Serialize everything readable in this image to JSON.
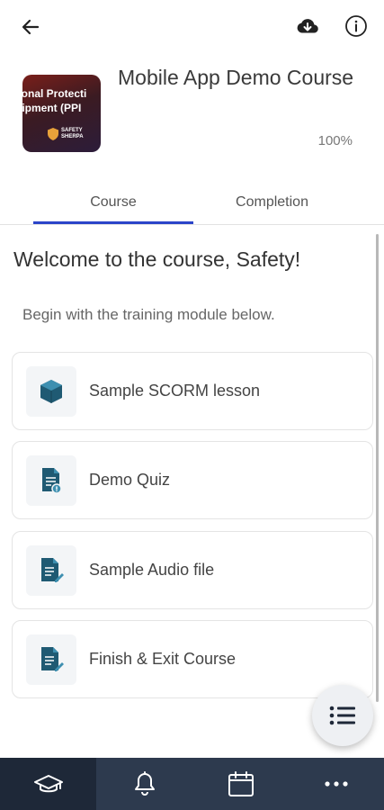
{
  "topbar": {
    "back_icon": "arrow-left-icon",
    "download_icon": "cloud-download-icon",
    "info_icon": "info-icon"
  },
  "course": {
    "thumbnail_line1": "sonal Protecti",
    "thumbnail_line2": "uipment (PPI",
    "thumbnail_badge_line1": "SAFETY",
    "thumbnail_badge_line2": "SHERPA",
    "title": "Mobile App Demo Course",
    "progress": "100%"
  },
  "tabs": [
    {
      "label": "Course",
      "active": true
    },
    {
      "label": "Completion",
      "active": false
    }
  ],
  "content": {
    "welcome": "Welcome to the course, Safety!",
    "subtitle": "Begin with the training module below."
  },
  "modules": [
    {
      "label": "Sample SCORM lesson",
      "icon": "cube-icon"
    },
    {
      "label": "Demo Quiz",
      "icon": "quiz-document-icon"
    },
    {
      "label": "Sample Audio file",
      "icon": "document-edit-icon"
    },
    {
      "label": "Finish & Exit Course",
      "icon": "document-edit-icon"
    }
  ],
  "fab": {
    "icon": "list-icon"
  },
  "bottom_nav": [
    {
      "icon": "graduation-cap-icon",
      "active": true
    },
    {
      "icon": "bell-icon",
      "active": false
    },
    {
      "icon": "calendar-icon",
      "active": false
    },
    {
      "icon": "more-icon",
      "active": false
    }
  ],
  "colors": {
    "accent": "#2b44c9",
    "icon_teal": "#1f5a73",
    "nav_bg": "#2d3a4e",
    "nav_active_bg": "#1e2838"
  }
}
